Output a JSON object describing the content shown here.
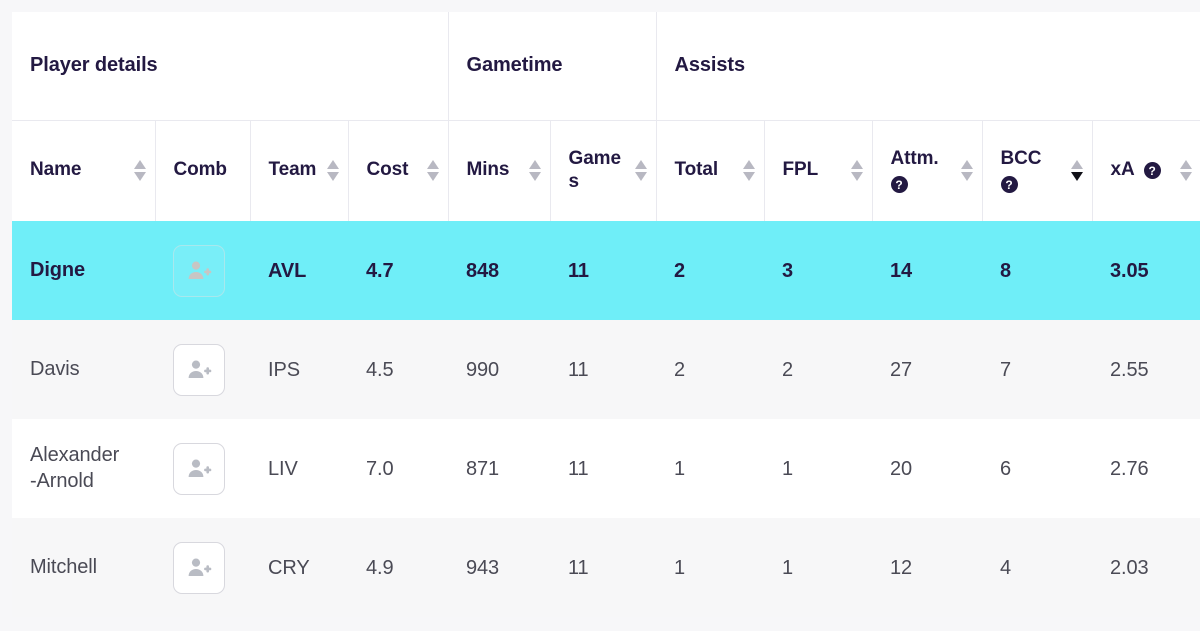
{
  "table": {
    "group_headers": [
      {
        "label": "Player details",
        "span": 4
      },
      {
        "label": "Gametime",
        "span": 2
      },
      {
        "label": "Assists",
        "span": 5
      }
    ],
    "columns": [
      {
        "key": "name",
        "label": "Name",
        "sortable": true,
        "sort_state": "none",
        "help": false
      },
      {
        "key": "comb",
        "label": "Comb",
        "sortable": false,
        "sort_state": "none",
        "help": false
      },
      {
        "key": "team",
        "label": "Team",
        "sortable": true,
        "sort_state": "none",
        "help": false
      },
      {
        "key": "cost",
        "label": "Cost",
        "sortable": true,
        "sort_state": "none",
        "help": false
      },
      {
        "key": "mins",
        "label": "Mins",
        "sortable": true,
        "sort_state": "none",
        "help": false
      },
      {
        "key": "games",
        "label": "Games",
        "sortable": true,
        "sort_state": "none",
        "help": false
      },
      {
        "key": "total",
        "label": "Total",
        "sortable": true,
        "sort_state": "none",
        "help": false
      },
      {
        "key": "fpl",
        "label": "FPL",
        "sortable": true,
        "sort_state": "none",
        "help": false
      },
      {
        "key": "attm",
        "label": "Attm.",
        "sortable": true,
        "sort_state": "none",
        "help": true
      },
      {
        "key": "bcc",
        "label": "BCC",
        "sortable": true,
        "sort_state": "desc",
        "help": true
      },
      {
        "key": "xa",
        "label": "xA",
        "sortable": true,
        "sort_state": "none",
        "help": true
      }
    ],
    "help_badge_glyph": "?",
    "add_button_label": "",
    "rows": [
      {
        "name": "Digne",
        "name_line1": "Digne",
        "name_line2": "",
        "team": "AVL",
        "cost": "4.7",
        "mins": "848",
        "games": "11",
        "total": "2",
        "fpl": "3",
        "attm": "14",
        "bcc": "8",
        "xa": "3.05",
        "selected": true,
        "striped": false
      },
      {
        "name": "Davis",
        "name_line1": "Davis",
        "name_line2": "",
        "team": "IPS",
        "cost": "4.5",
        "mins": "990",
        "games": "11",
        "total": "2",
        "fpl": "2",
        "attm": "27",
        "bcc": "7",
        "xa": "2.55",
        "selected": false,
        "striped": true
      },
      {
        "name": "Alexander-Arnold",
        "name_line1": "Alexander",
        "name_line2": "-Arnold",
        "team": "LIV",
        "cost": "7.0",
        "mins": "871",
        "games": "11",
        "total": "1",
        "fpl": "1",
        "attm": "20",
        "bcc": "6",
        "xa": "2.76",
        "selected": false,
        "striped": false
      },
      {
        "name": "Mitchell",
        "name_line1": "Mitchell",
        "name_line2": "",
        "team": "CRY",
        "cost": "4.9",
        "mins": "943",
        "games": "11",
        "total": "1",
        "fpl": "1",
        "attm": "12",
        "bcc": "4",
        "xa": "2.03",
        "selected": false,
        "striped": true
      }
    ]
  },
  "colors": {
    "selected_row": "#6FEEF8",
    "header_text": "#231942",
    "body_text": "#4a4a55",
    "stripe": "#f7f7f8",
    "border": "#e9e9ef",
    "page_bg": "#f7f7f9"
  }
}
